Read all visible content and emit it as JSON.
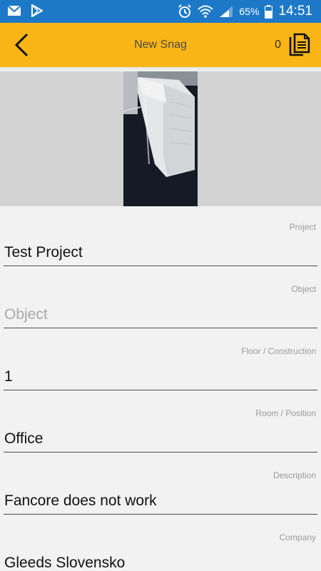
{
  "status_bar": {
    "battery": "65%",
    "time": "14:51",
    "icons": [
      "mail-icon",
      "play-store-icon",
      "alarm-icon",
      "wifi-icon",
      "signal-icon",
      "battery-icon"
    ]
  },
  "app_bar": {
    "title": "New Snag",
    "count": "0",
    "accent_color": "#fbb516",
    "status_color": "#1e78c8"
  },
  "form": {
    "fields": [
      {
        "label": "Project",
        "value": "Test Project",
        "placeholder": ""
      },
      {
        "label": "Object",
        "value": "",
        "placeholder": "Object"
      },
      {
        "label": "Floor / Construction",
        "value": "1",
        "placeholder": ""
      },
      {
        "label": "Room / Position",
        "value": "Office",
        "placeholder": ""
      },
      {
        "label": "Description",
        "value": "Fancore does not work",
        "placeholder": ""
      },
      {
        "label": "Company",
        "value": "Gleeds Slovensko",
        "placeholder": ""
      }
    ]
  }
}
